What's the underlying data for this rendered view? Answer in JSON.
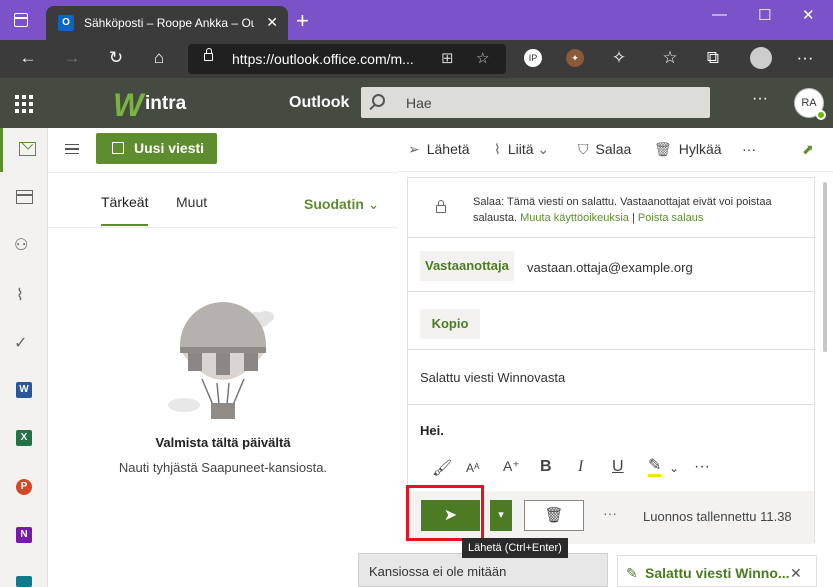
{
  "browser": {
    "tab_title": "Sähköposti – Roope Ankka – Outlook",
    "url": "https://outlook.office.com/m...",
    "new_tab_glyph": "+",
    "window_controls": [
      "—",
      "☐",
      "✕"
    ]
  },
  "header": {
    "logo_mark": "W",
    "logo_text": "intra",
    "app_name": "Outlook",
    "search_placeholder": "Hae",
    "more": "···",
    "avatar_initials": "RA"
  },
  "rail": {
    "icons": [
      "mail-icon",
      "calendar-icon",
      "people-icon",
      "attachment-icon",
      "todo-icon",
      "word-icon",
      "excel-icon",
      "powerpoint-icon",
      "onenote-icon"
    ],
    "office_letters": {
      "word": "W",
      "excel": "X",
      "powerpoint": "P",
      "onenote": "N"
    },
    "office_colors": {
      "word": "#2b579a",
      "excel": "#217346",
      "powerpoint": "#d24726",
      "onenote": "#7719aa"
    }
  },
  "mailbox": {
    "new_message": "Uusi viesti",
    "tabs": [
      "Tärkeät",
      "Muut"
    ],
    "filter": "Suodatin",
    "empty_title": "Valmista tältä päivältä",
    "empty_subtitle": "Nauti tyhjästä Saapuneet-kansiosta.",
    "folder_empty": "Kansiossa ei ole mitään"
  },
  "compose_toolbar": {
    "send": "Lähetä",
    "attach": "Liitä",
    "encrypt": "Salaa",
    "discard": "Hylkää",
    "more": "···"
  },
  "compose": {
    "encryption_notice": "Salaa: Tämä viesti on salattu. Vastaanottajat eivät voi poistaa salausta.",
    "change_permissions": "Muuta käyttöoikeuksia",
    "separator": "|",
    "remove_encryption": "Poista salaus",
    "to_label": "Vastaanottaja",
    "to_value": "vastaan.ottaja@example.org",
    "cc_label": "Kopio",
    "subject": "Salattu viesti Winnovasta",
    "body": "Hei.",
    "saved_status": "Luonnos tallennettu 11.38",
    "send_tooltip": "Lähetä (Ctrl+Enter)",
    "more": "···"
  },
  "draft_tab": {
    "label": "Salattu viesti Winno..."
  },
  "colors": {
    "accent": "#5d8d2e",
    "accent_dark": "#4c7b23",
    "header_bg": "#454b40",
    "browser_title_bg": "#7b52c7",
    "highlight": "#e81123"
  }
}
